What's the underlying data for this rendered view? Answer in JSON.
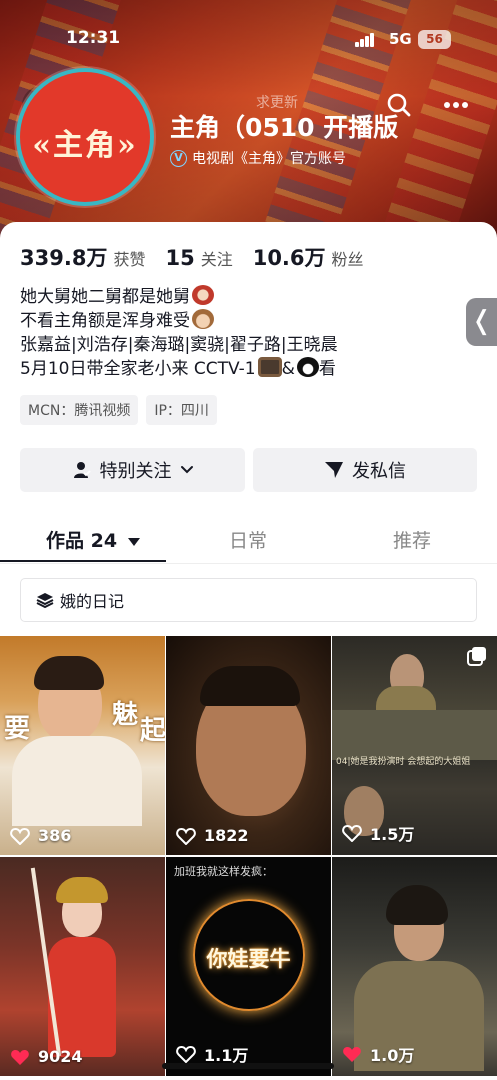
{
  "status_bar": {
    "time": "12:31",
    "network": "5G",
    "battery": "56"
  },
  "header": {
    "hint_text": "求更新",
    "avatar_logo": "«主角»",
    "account_name": "主角（0510 开播版",
    "verified_label": "电视剧《主角》官方账号"
  },
  "stats": [
    {
      "value": "339.8万",
      "label": "获赞"
    },
    {
      "value": "15",
      "label": "关注"
    },
    {
      "value": "10.6万",
      "label": "粉丝"
    }
  ],
  "bio": {
    "line1": "她大舅她二舅都是她舅",
    "line2": "不看主角额是浑身难受",
    "line3": "张嘉益|刘浩存|秦海璐|窦骁|翟子路|王晓晨",
    "line4_a": "5月10日带全家老小来 CCTV-1",
    "line4_b": "&",
    "line4_c": "看"
  },
  "tags": {
    "mcn": "MCN：腾讯视频",
    "ip": "IP：四川"
  },
  "buttons": {
    "follow": "特别关注",
    "message": "发私信"
  },
  "side_handle": "❬",
  "tabs": {
    "works": "作品 24",
    "daily": "日常",
    "recommend": "推荐"
  },
  "collection": {
    "label": "娥的日记"
  },
  "videos": [
    {
      "likes": "386",
      "overlay_a": "要",
      "overlay_b": "魅",
      "overlay_c": "起"
    },
    {
      "likes": "1822"
    },
    {
      "likes": "1.5万",
      "subtitle": "04|她是我扮演时 会想起的大姐姐"
    },
    {
      "likes": "9024"
    },
    {
      "likes": "1.1万",
      "caption": "加班我就这样发疯：",
      "glow": "你娃要牛"
    },
    {
      "likes": "1.0万"
    }
  ],
  "colors": {
    "accent_red": "#e2392a",
    "avatar_ring": "#39b7c4",
    "liked_heart": "#ff2b54"
  }
}
